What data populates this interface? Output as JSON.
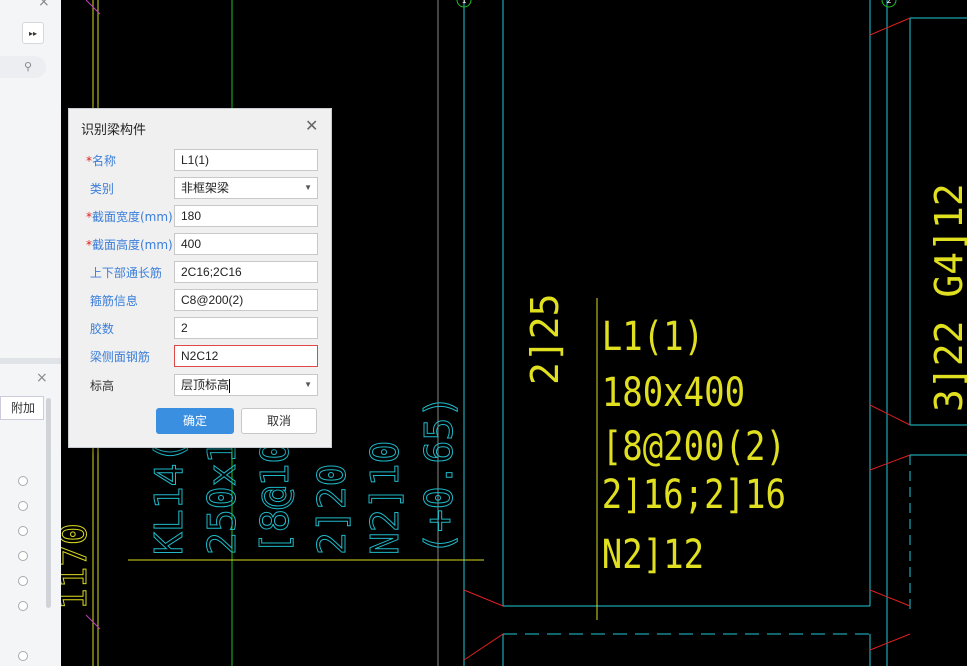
{
  "left_panel": {
    "add_label": "附加"
  },
  "dialog": {
    "title": "识别梁构件",
    "fields": [
      {
        "label": "名称",
        "required": true,
        "value": "L1(1)",
        "type": "text"
      },
      {
        "label": "类别",
        "required": false,
        "value": "非框架梁",
        "type": "select"
      },
      {
        "label": "截面宽度(mm)",
        "required": true,
        "value": "180",
        "type": "text"
      },
      {
        "label": "截面高度(mm)",
        "required": true,
        "value": "400",
        "type": "text"
      },
      {
        "label": "上下部通长筋",
        "required": false,
        "value": "2C16;2C16",
        "type": "text"
      },
      {
        "label": "箍筋信息",
        "required": false,
        "value": "C8@200(2)",
        "type": "text"
      },
      {
        "label": "胶数",
        "required": false,
        "value": "2",
        "type": "text"
      },
      {
        "label": "梁侧面钢筋",
        "required": false,
        "value": "N2C12",
        "type": "text"
      },
      {
        "label": "标高",
        "required": false,
        "value": "层顶标高",
        "type": "select"
      }
    ],
    "ok_label": "确定",
    "cancel_label": "取消"
  },
  "cad": {
    "axis_labels": [
      "1",
      "2"
    ],
    "beam_annotation": [
      "L1(1)",
      "180x400",
      "[8@200(2)",
      "2]16;2]16",
      "N2]12"
    ],
    "left_vertical_text": "2]25",
    "right_vertical_text": "3]22 G4]12",
    "kl_annotation": [
      "KL14(2",
      "250x1",
      "[8@100(",
      "2]20",
      "N2]10",
      "(+0.65)"
    ],
    "bottom_left_text": "1170"
  }
}
